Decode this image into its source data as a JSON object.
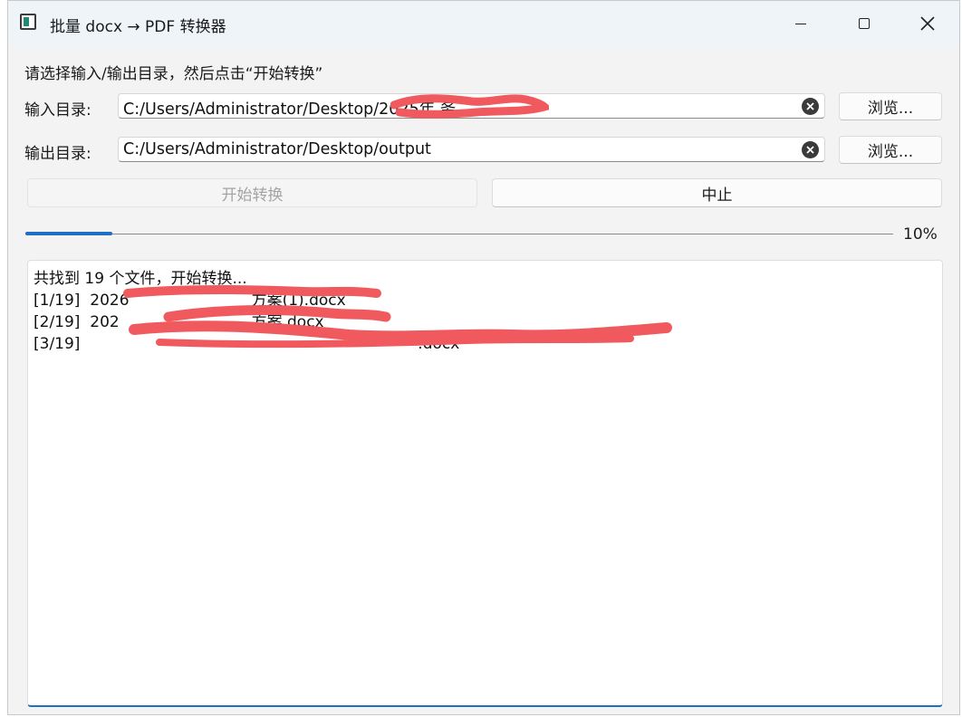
{
  "window": {
    "title": "批量 docx → PDF 转换器"
  },
  "instruction": "请选择输入/输出目录，然后点击“开始转换”",
  "input_dir": {
    "label": "输入目录:",
    "value": "C:/Users/Administrator/Desktop/2025年    务",
    "browse_label": "浏览..."
  },
  "output_dir": {
    "label": "输出目录:",
    "value": "C:/Users/Administrator/Desktop/output",
    "browse_label": "浏览..."
  },
  "actions": {
    "start_label": "开始转换",
    "stop_label": "中止"
  },
  "progress": {
    "percent_text": "10%",
    "fraction": 0.1
  },
  "log": {
    "lines": [
      "共找到 19 个文件，开始转换...",
      "[1/19]  2026                         方案(1).docx",
      "[2/19]  202                           方案.docx",
      "[3/19]                                                                     .docx"
    ]
  },
  "colors": {
    "accent": "#1f6fc4",
    "redaction": "#f05a5f"
  }
}
